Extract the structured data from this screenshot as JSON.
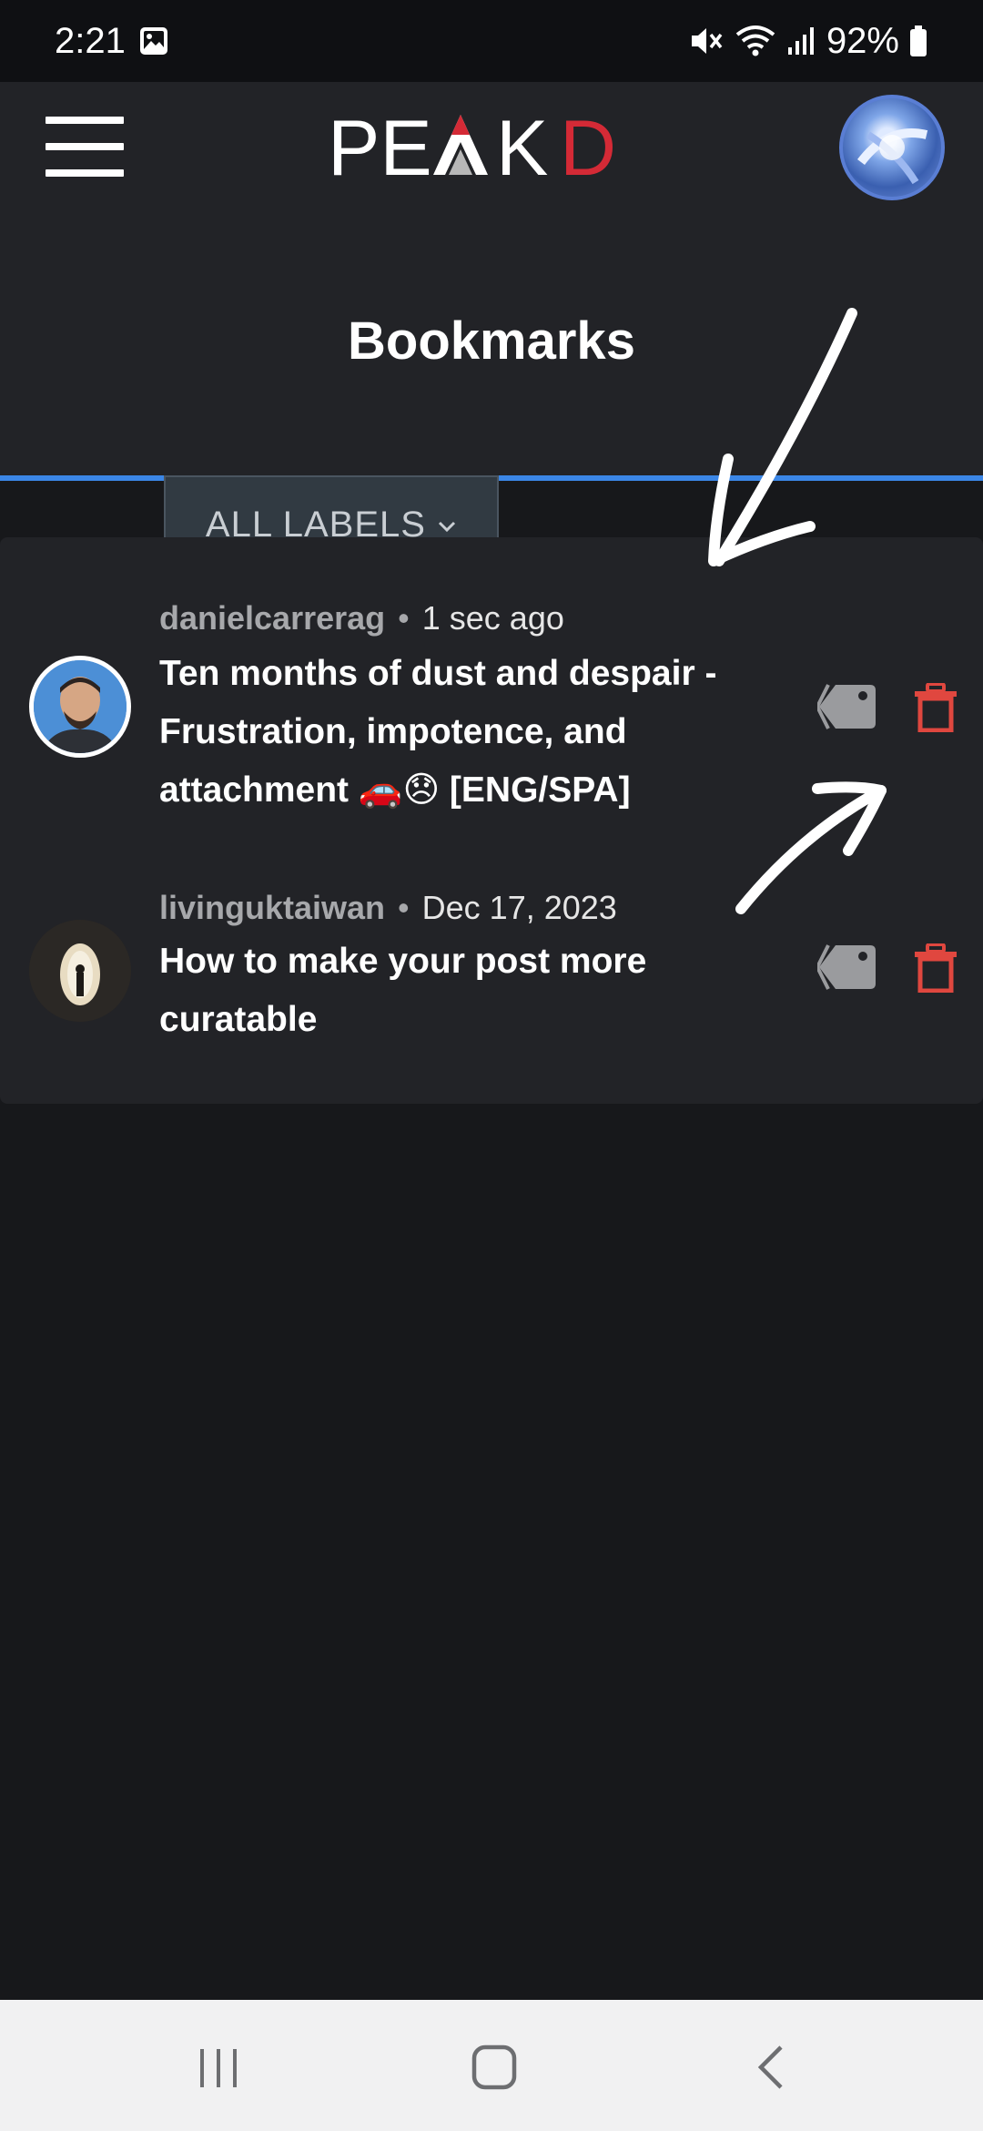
{
  "status_bar": {
    "time": "2:21",
    "battery": "92%"
  },
  "header": {
    "logo_text": "PEAKD",
    "menu_icon": "hamburger-menu-icon",
    "avatar_icon": "user-avatar"
  },
  "page": {
    "title": "Bookmarks",
    "labels_filter": "ALL LABELS"
  },
  "bookmarks": [
    {
      "author": "danielcarrerag",
      "time": "1 sec ago",
      "title": "Ten months of dust and despair - Frustration, impotence, and attachment 🚗😞 [ENG/SPA]"
    },
    {
      "author": "livinguktaiwan",
      "time": "Dec 17, 2023",
      "title": "How to make your post more curatable"
    }
  ],
  "colors": {
    "accent_blue": "#3b86e6",
    "delete_red": "#e0473f",
    "tag_gray": "#9a9b9e",
    "logo_red": "#d42a36"
  },
  "nav_bar": {
    "recent_icon": "recent-apps-icon",
    "home_icon": "home-icon",
    "back_icon": "back-icon"
  }
}
